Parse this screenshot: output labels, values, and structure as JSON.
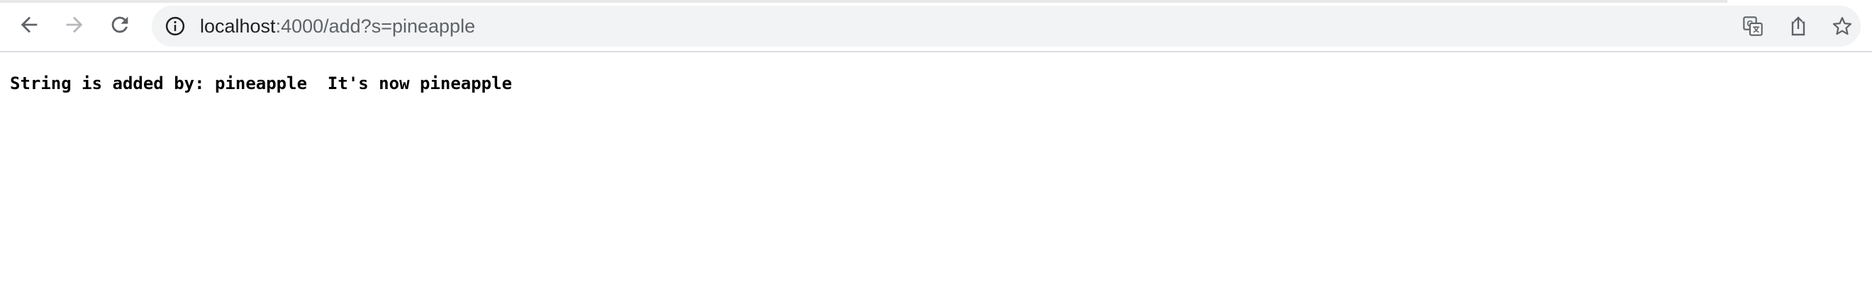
{
  "browser": {
    "url_host": "localhost",
    "url_rest": ":4000/add?s=pineapple",
    "icons": {
      "back": "arrow-left-icon",
      "forward": "arrow-right-icon",
      "reload": "reload-icon",
      "site_info": "info-icon",
      "translate": "translate-icon",
      "share": "share-icon",
      "bookmark": "star-icon"
    },
    "colors": {
      "toolbar_bg": "#ffffff",
      "omnibox_bg": "#f1f3f4",
      "icon_active": "#5f6368",
      "icon_disabled": "#b5b7ba"
    }
  },
  "page": {
    "message": "String is added by: pineapple  It's now pineapple"
  }
}
